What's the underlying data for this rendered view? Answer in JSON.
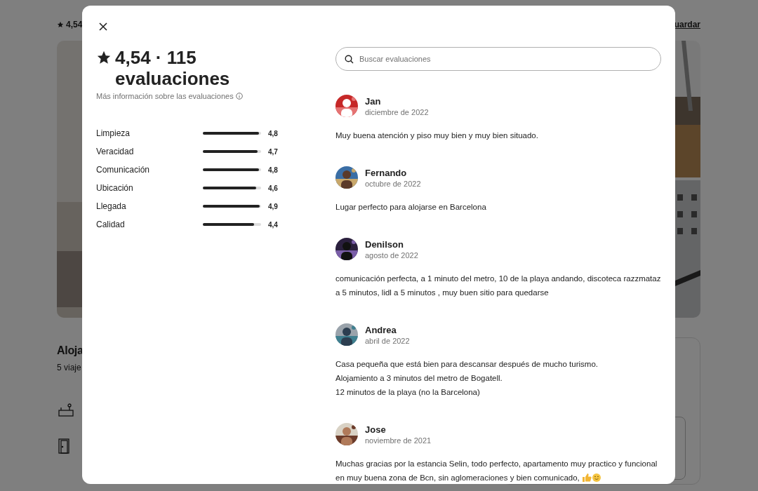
{
  "page": {
    "rating": "4,54",
    "save_link": "uardar",
    "section_title": "Aloja",
    "section_subtitle": "5 viaje"
  },
  "modal": {
    "heading": "4,54 · 115 evaluaciones",
    "info_link": "Más información sobre las evaluaciones",
    "categories": [
      {
        "label": "Limpieza",
        "level": 0.96,
        "value": "4,8"
      },
      {
        "label": "Veracidad",
        "level": 0.94,
        "value": "4,7"
      },
      {
        "label": "Comunicación",
        "level": 0.96,
        "value": "4,8"
      },
      {
        "label": "Ubicación",
        "level": 0.92,
        "value": "4,6"
      },
      {
        "label": "Llegada",
        "level": 0.98,
        "value": "4,9"
      },
      {
        "label": "Calidad",
        "level": 0.88,
        "value": "4,4"
      }
    ],
    "search": {
      "placeholder": "Buscar evaluaciones"
    },
    "reviews": [
      {
        "name": "Jan",
        "date": "diciembre de 2022",
        "text": "Muy buena atención y piso muy bien y muy bien situado.",
        "kind": "plain"
      },
      {
        "name": "Fernando",
        "date": "octubre de 2022",
        "text": "Lugar perfecto para alojarse en Barcelona",
        "kind": "plain"
      },
      {
        "name": "Denilson",
        "date": "agosto de 2022",
        "text": "comunicación perfecta, a 1 minuto del metro, 10 de la playa andando, discoteca razzmataz a 5 minutos, lidl a 5 minutos , muy buen sitio para quedarse",
        "kind": "plain"
      },
      {
        "name": "Andrea",
        "date": "abril de 2022",
        "text": "Casa pequeña que está bien para descansar después de mucho turismo.\nAlojamiento a 3 minutos del metro de Bogatell.\n12 minutos de la playa (no la Barcelona)",
        "kind": "plain"
      },
      {
        "name": "Jose",
        "date": "noviembre de 2021",
        "text": "Muchas gracias por la estancia Selin, todo perfecto, apartamento muy practico y funcional en muy buena zona de Bcn, sin aglomeraciones y bien comunicado,",
        "kind": "emoji"
      }
    ]
  }
}
